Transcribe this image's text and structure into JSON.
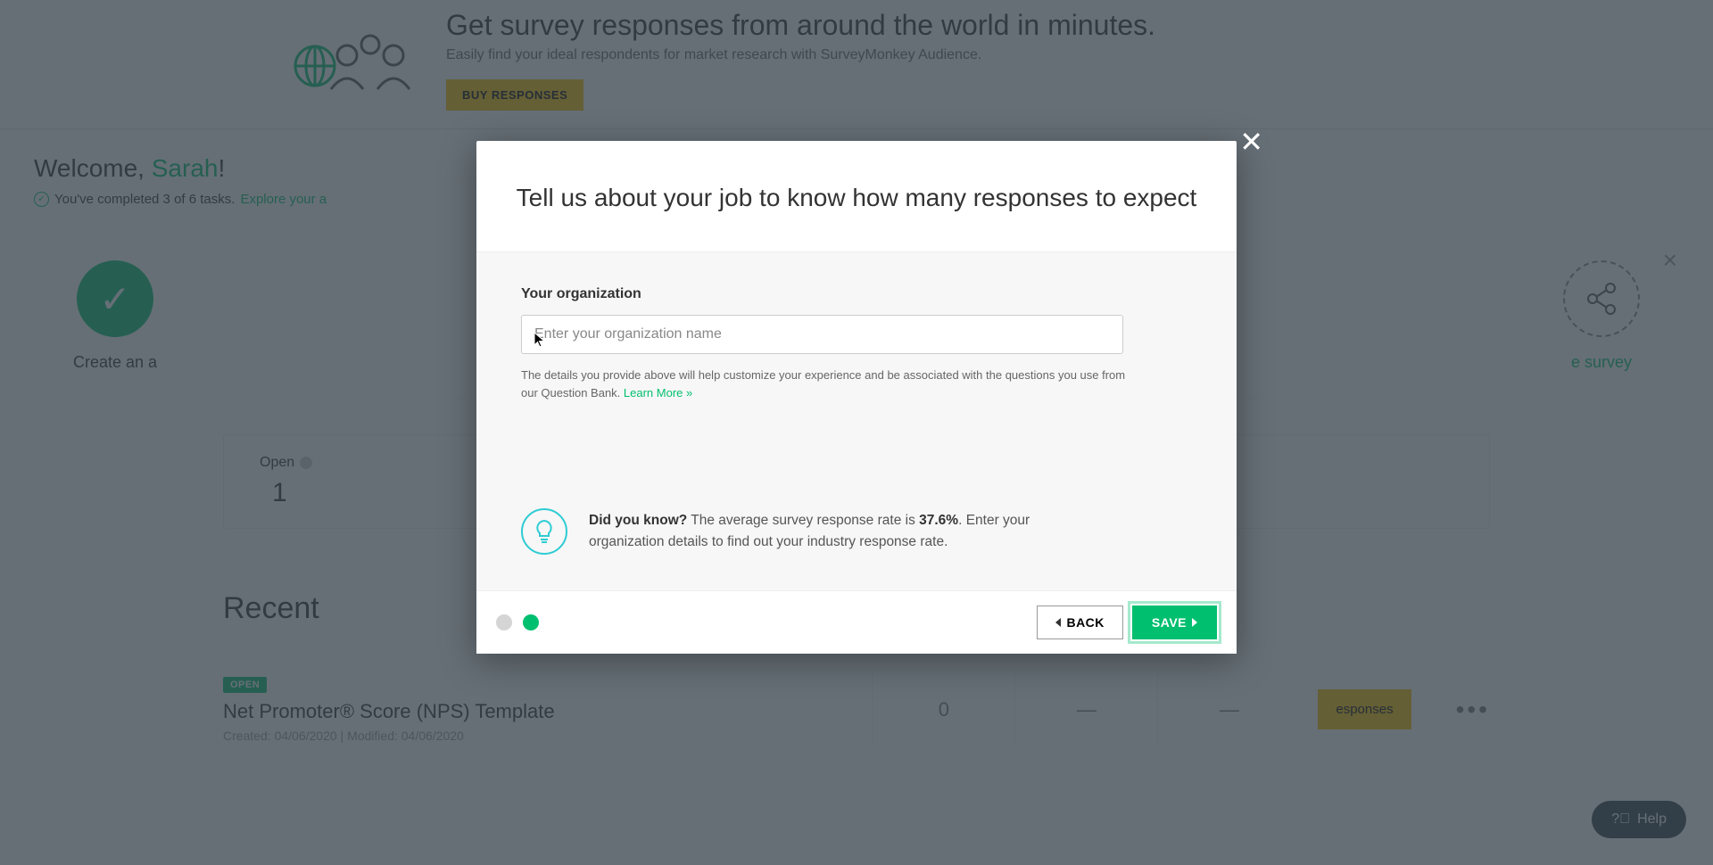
{
  "banner": {
    "heading": "Get survey responses from around the world in minutes.",
    "sub": "Easily find your ideal respondents for market research with SurveyMonkey Audience.",
    "buy": "BUY RESPONSES"
  },
  "welcome": {
    "prefix": "Welcome, ",
    "name": "Sarah",
    "bang": "!",
    "tasks_text": "You've completed 3 of 6 tasks.",
    "explore": "Explore your a"
  },
  "steps": {
    "s1": "Create an a",
    "s5": "e survey"
  },
  "stats": {
    "open_label": "Open",
    "open_value": "1"
  },
  "recent": {
    "heading": "Recent",
    "badge": "OPEN",
    "title": "Net Promoter® Score (NPS) Template",
    "dates": "Created: 04/06/2020    |    Modified: 04/06/2020",
    "c1": "0",
    "c2": "—",
    "c3": "—",
    "buy_responses": "esponses"
  },
  "modal": {
    "title": "Tell us about your job to know how many responses to expect",
    "org_label": "Your organization",
    "org_placeholder": "Enter your organization name",
    "helper_pre": "The details you provide above will help customize your experience and be associated with the questions you use from our Question Bank. ",
    "learn_more": "Learn More »",
    "dyk_label": "Did you know?",
    "dyk_mid1": " The average survey response rate is ",
    "dyk_pct": "37.6%",
    "dyk_mid2": ". Enter your organization details to find out your industry response rate.",
    "back": "BACK",
    "save": "SAVE"
  },
  "help": {
    "label": "Help"
  }
}
